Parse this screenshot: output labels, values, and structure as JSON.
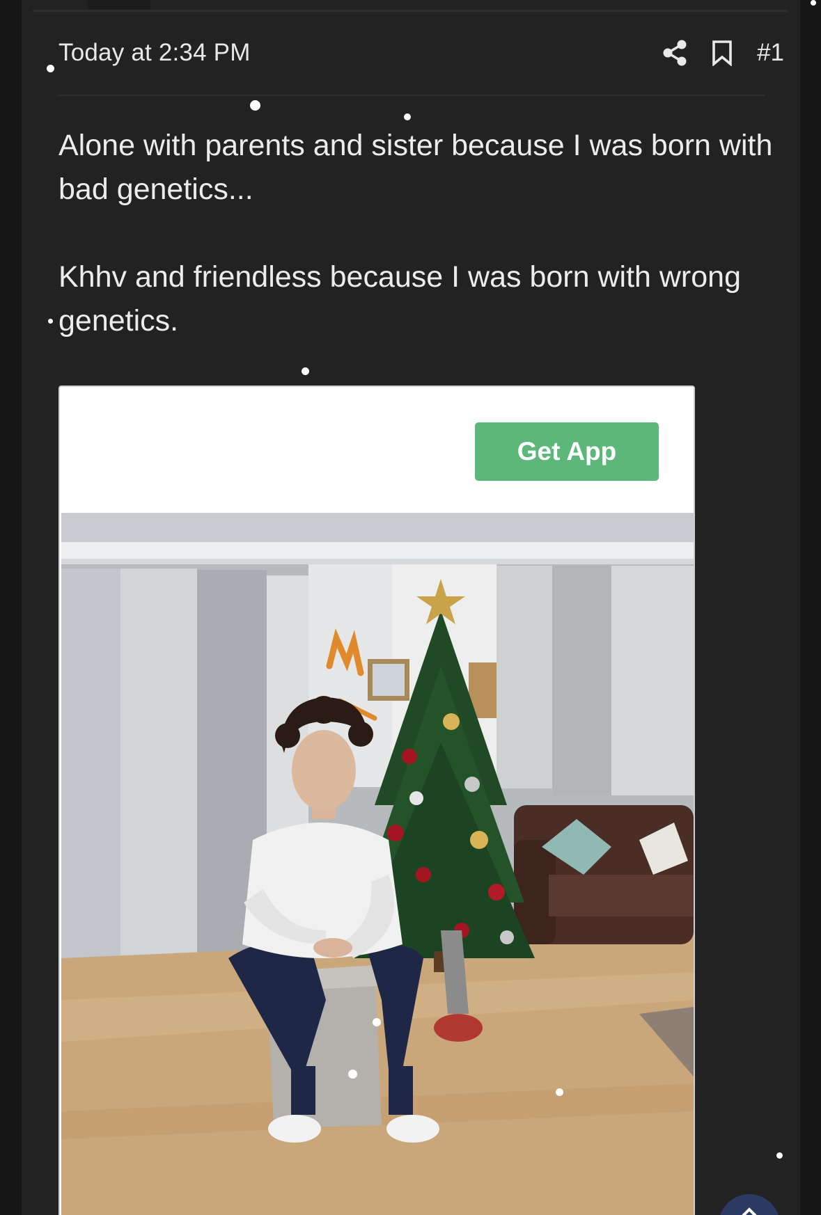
{
  "post": {
    "timestamp": "Today at 2:34 PM",
    "post_number": "#1",
    "paragraphs": [
      "Alone with parents and sister because I was born with bad genetics...",
      "Khhv and friendless because I was born with wrong genetics."
    ],
    "actions": [
      {
        "icon": "share-icon"
      },
      {
        "icon": "bookmark-icon"
      }
    ]
  },
  "ad": {
    "button_label": "Get App",
    "button_color": "#5db77a"
  },
  "photo": {
    "subject": "man seated on a storage ottoman beside a decorated Christmas tree in a living room"
  },
  "scroll_top": {
    "icon": "chevron-up-icon"
  },
  "theme": {
    "background": "#161617",
    "post_background": "#222223",
    "text": "#ececec",
    "fab": "#2b3a63"
  }
}
